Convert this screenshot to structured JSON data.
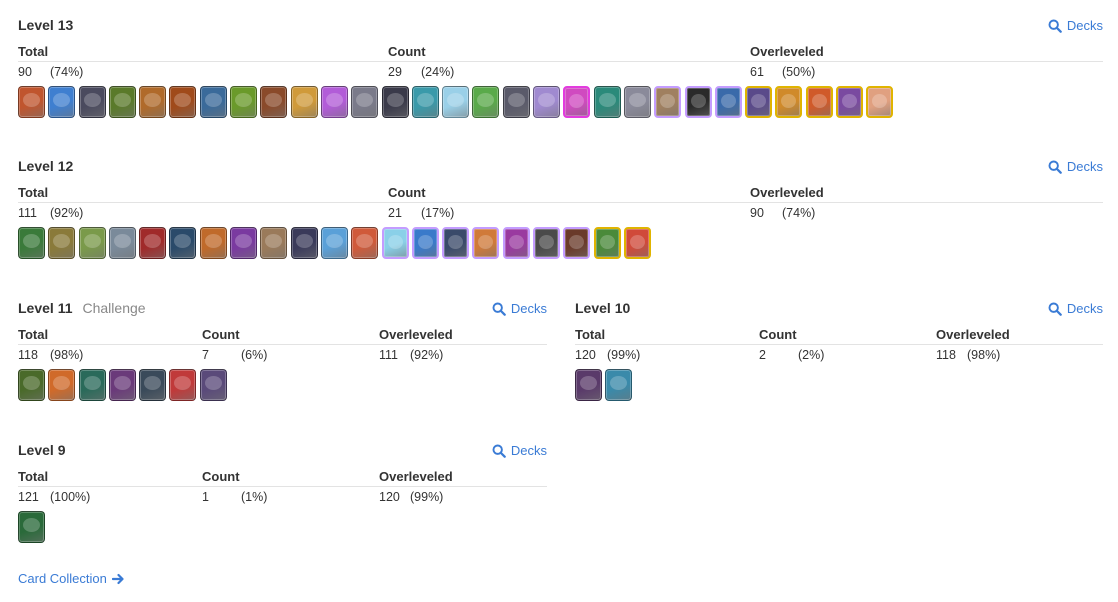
{
  "levels": [
    {
      "title": "Level 13",
      "subtitle": "",
      "decks_label": "Decks",
      "headers": [
        "Total",
        "Count",
        "Overleveled"
      ],
      "total": "90",
      "total_pct": "(74%)",
      "count": "29",
      "count_pct": "(24%)",
      "over": "61",
      "over_pct": "(50%)",
      "cards": [
        {
          "icon": "card-icon",
          "color": "#c0552e"
        },
        {
          "icon": "card-icon",
          "color": "#3f7fd0"
        },
        {
          "icon": "card-icon",
          "color": "#4a4a5e"
        },
        {
          "icon": "card-icon",
          "color": "#5a7a2a"
        },
        {
          "icon": "card-icon",
          "color": "#b06a2a"
        },
        {
          "icon": "card-icon",
          "color": "#a04a1a"
        },
        {
          "icon": "card-icon",
          "color": "#3a6a9a"
        },
        {
          "icon": "card-icon",
          "color": "#6a9a2a"
        },
        {
          "icon": "card-icon",
          "color": "#8a4a2a"
        },
        {
          "icon": "card-icon",
          "color": "#d09a3a"
        },
        {
          "icon": "card-icon",
          "color": "#b25cd8"
        },
        {
          "icon": "card-icon",
          "color": "#7a7a8a"
        },
        {
          "icon": "card-icon",
          "color": "#3a3a4a"
        },
        {
          "icon": "card-icon",
          "color": "#3a9aaa"
        },
        {
          "icon": "card-icon",
          "color": "#9ad0e8"
        },
        {
          "icon": "card-icon",
          "color": "#5aaa4a"
        },
        {
          "icon": "card-icon",
          "color": "#5a5a6a"
        },
        {
          "icon": "card-icon",
          "color": "#a08ad0"
        },
        {
          "icon": "card-icon",
          "color": "#d04ac0",
          "legend": "leg-pink"
        },
        {
          "icon": "card-icon",
          "color": "#2a8a7a"
        },
        {
          "icon": "card-icon",
          "color": "#8a8a9a"
        },
        {
          "icon": "card-icon",
          "color": "#a08060",
          "legend": "legend"
        },
        {
          "icon": "card-icon",
          "color": "#2a2a2a",
          "legend": "legend"
        },
        {
          "icon": "card-icon",
          "color": "#3a6aaa",
          "legend": "legend"
        },
        {
          "icon": "card-icon",
          "color": "#5a4a8a",
          "legend": "gold"
        },
        {
          "icon": "card-icon",
          "color": "#d08a2a",
          "legend": "gold"
        },
        {
          "icon": "card-icon",
          "color": "#d05a2a",
          "legend": "gold"
        },
        {
          "icon": "card-icon",
          "color": "#7a4aa0",
          "legend": "gold"
        },
        {
          "icon": "card-icon",
          "color": "#e0a080",
          "legend": "gold"
        }
      ]
    },
    {
      "title": "Level 12",
      "subtitle": "",
      "decks_label": "Decks",
      "headers": [
        "Total",
        "Count",
        "Overleveled"
      ],
      "total": "111",
      "total_pct": "(92%)",
      "count": "21",
      "count_pct": "(17%)",
      "over": "90",
      "over_pct": "(74%)",
      "cards": [
        {
          "icon": "card-icon",
          "color": "#3a7a3a"
        },
        {
          "icon": "card-icon",
          "color": "#8a7a3a"
        },
        {
          "icon": "card-icon",
          "color": "#7a9a4a"
        },
        {
          "icon": "card-icon",
          "color": "#7a8a9a"
        },
        {
          "icon": "card-icon",
          "color": "#a02a2a"
        },
        {
          "icon": "card-icon",
          "color": "#2a4a6a"
        },
        {
          "icon": "card-icon",
          "color": "#c06a2a"
        },
        {
          "icon": "card-icon",
          "color": "#7a3aa0"
        },
        {
          "icon": "card-icon",
          "color": "#9a7a5a"
        },
        {
          "icon": "card-icon",
          "color": "#3a3a5a"
        },
        {
          "icon": "card-icon",
          "color": "#5aa0d8"
        },
        {
          "icon": "card-icon",
          "color": "#d05a3a"
        },
        {
          "icon": "card-icon",
          "color": "#8ad0e8",
          "legend": "legend"
        },
        {
          "icon": "card-icon",
          "color": "#3a7aca",
          "legend": "legend"
        },
        {
          "icon": "card-icon",
          "color": "#3a4a6a",
          "legend": "legend"
        },
        {
          "icon": "card-icon",
          "color": "#d07a3a",
          "legend": "legend"
        },
        {
          "icon": "card-icon",
          "color": "#9a3aa0",
          "legend": "legend"
        },
        {
          "icon": "card-icon",
          "color": "#4a4a4a",
          "legend": "legend"
        },
        {
          "icon": "card-icon",
          "color": "#6a3a2a",
          "legend": "legend"
        },
        {
          "icon": "card-icon",
          "color": "#4a8a3a",
          "legend": "gold"
        },
        {
          "icon": "card-icon",
          "color": "#d04a3a",
          "legend": "gold"
        }
      ]
    },
    {
      "title": "Level 11",
      "subtitle": "Challenge",
      "decks_label": "Decks",
      "headers": [
        "Total",
        "Count",
        "Overleveled"
      ],
      "total": "118",
      "total_pct": "(98%)",
      "count": "7",
      "count_pct": "(6%)",
      "over": "111",
      "over_pct": "(92%)",
      "cards": [
        {
          "icon": "card-icon",
          "color": "#4a6a2a"
        },
        {
          "icon": "card-icon",
          "color": "#d06a2a"
        },
        {
          "icon": "card-icon",
          "color": "#2a6a5a"
        },
        {
          "icon": "card-icon",
          "color": "#6a3a7a"
        },
        {
          "icon": "card-icon",
          "color": "#3a4a5a"
        },
        {
          "icon": "card-icon",
          "color": "#c03a3a"
        },
        {
          "icon": "card-icon",
          "color": "#5a4a7a"
        }
      ]
    },
    {
      "title": "Level 10",
      "subtitle": "",
      "decks_label": "Decks",
      "headers": [
        "Total",
        "Count",
        "Overleveled"
      ],
      "total": "120",
      "total_pct": "(99%)",
      "count": "2",
      "count_pct": "(2%)",
      "over": "118",
      "over_pct": "(98%)",
      "cards": [
        {
          "icon": "card-icon",
          "color": "#5a3a6a"
        },
        {
          "icon": "card-icon",
          "color": "#3a8aaa"
        }
      ]
    },
    {
      "title": "Level 9",
      "subtitle": "",
      "decks_label": "Decks",
      "headers": [
        "Total",
        "Count",
        "Overleveled"
      ],
      "total": "121",
      "total_pct": "(100%)",
      "count": "1",
      "count_pct": "(1%)",
      "over": "120",
      "over_pct": "(99%)",
      "cards": [
        {
          "icon": "card-icon",
          "color": "#2a6a3a"
        }
      ]
    }
  ],
  "footer": {
    "label": "Card Collection"
  },
  "colors": {
    "link": "#3a7bd5",
    "text": "#333333",
    "muted": "#888888"
  }
}
